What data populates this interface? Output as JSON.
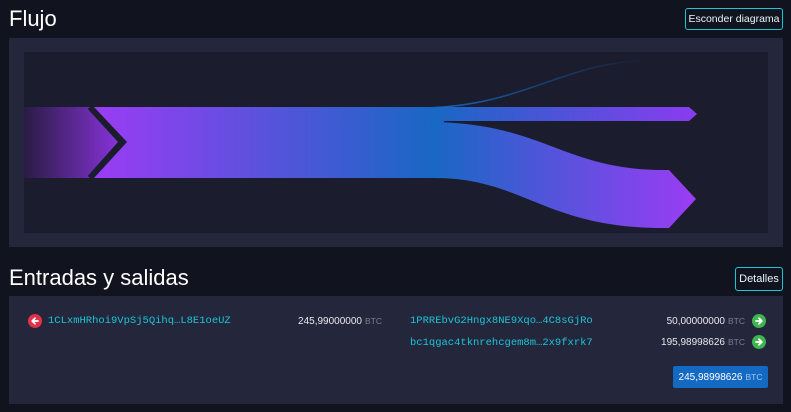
{
  "flow": {
    "title": "Flujo",
    "toggle_label": "Esconder diagrama"
  },
  "io": {
    "title": "Entradas y salidas",
    "details_label": "Detalles",
    "inputs": [
      {
        "address": "1CLxmHRhoi9VpSj5Qihq…L8E1oeUZ",
        "amount": "245,99000000",
        "unit": "BTC"
      }
    ],
    "outputs": [
      {
        "address": "1PRREbvG2Hngx8NE9Xqo…4C8sGjRo",
        "amount": "50,00000000",
        "unit": "BTC"
      },
      {
        "address": "bc1qgac4tknrehcgem8m…2x9fxrk7",
        "amount": "195,98998626",
        "unit": "BTC"
      }
    ],
    "total": {
      "amount": "245,98998626",
      "unit": "BTC"
    }
  },
  "colors": {
    "background": "#11131f",
    "panel": "#24263b",
    "accent": "#1bc6d6",
    "input_icon": "#e0334a",
    "output_icon": "#3fb54f",
    "flow_purple": "#9b3cf5",
    "flow_blue": "#1469c2"
  },
  "icons": {
    "input": "arrow-left-circle-icon",
    "output": "arrow-right-circle-icon"
  }
}
